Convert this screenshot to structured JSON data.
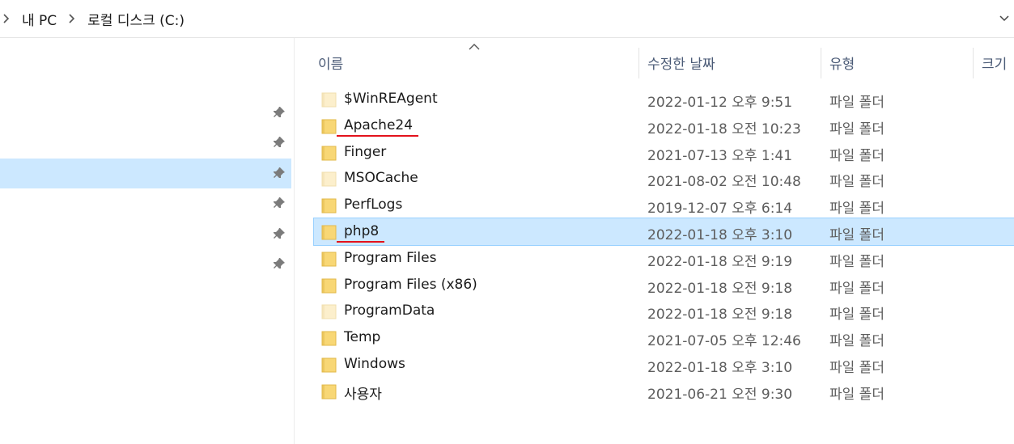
{
  "address": {
    "crumbs": [
      "내 PC",
      "로컬 디스크 (C:)"
    ]
  },
  "columns": {
    "name": "이름",
    "date": "수정한 날짜",
    "type": "유형",
    "size": "크기"
  },
  "files": [
    {
      "name": "$WinREAgent",
      "date": "2022-01-12 오후 9:51",
      "type": "파일 폴더",
      "faded": true
    },
    {
      "name": "Apache24",
      "date": "2022-01-18 오전 10:23",
      "type": "파일 폴더",
      "faded": false,
      "underlined": true
    },
    {
      "name": "Finger",
      "date": "2021-07-13 오후 1:41",
      "type": "파일 폴더",
      "faded": false
    },
    {
      "name": "MSOCache",
      "date": "2021-08-02 오전 10:48",
      "type": "파일 폴더",
      "faded": true
    },
    {
      "name": "PerfLogs",
      "date": "2019-12-07 오후 6:14",
      "type": "파일 폴더",
      "faded": false
    },
    {
      "name": "php8",
      "date": "2022-01-18 오후 3:10",
      "type": "파일 폴더",
      "faded": false,
      "selected": true,
      "underlined": true
    },
    {
      "name": "Program Files",
      "date": "2022-01-18 오전 9:19",
      "type": "파일 폴더",
      "faded": false
    },
    {
      "name": "Program Files (x86)",
      "date": "2022-01-18 오전 9:18",
      "type": "파일 폴더",
      "faded": false
    },
    {
      "name": "ProgramData",
      "date": "2022-01-18 오전 9:18",
      "type": "파일 폴더",
      "faded": true
    },
    {
      "name": "Temp",
      "date": "2021-07-05 오후 12:46",
      "type": "파일 폴더",
      "faded": false
    },
    {
      "name": "Windows",
      "date": "2022-01-18 오후 3:10",
      "type": "파일 폴더",
      "faded": false
    },
    {
      "name": "사용자",
      "date": "2021-06-21 오전 9:30",
      "type": "파일 폴더",
      "faded": false
    }
  ],
  "nav": {
    "pinned_count": 6,
    "selected_index": 2
  },
  "colors": {
    "selection": "#cce8ff",
    "selection_border": "#99d1ff",
    "folder": "#f8d775",
    "annotation": "#e3121c"
  },
  "icons": {
    "folder": "folder-icon",
    "pin": "pin-icon",
    "sort": "sort-ascending-icon",
    "chevron": "chevron-right-icon"
  }
}
